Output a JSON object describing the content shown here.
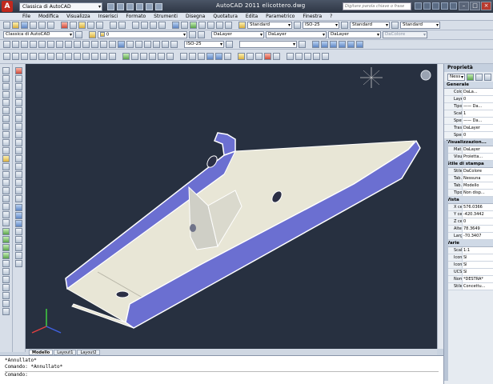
{
  "app": {
    "title": "AutoCAD 2011    elicottero.dwg",
    "workspace": "Classica di AutoCAD",
    "search_placeholder": "Digitare parola chiave o frase"
  },
  "menu": [
    "File",
    "Modifica",
    "Visualizza",
    "Inserisci",
    "Formato",
    "Strumenti",
    "Disegna",
    "Quotatura",
    "Edita",
    "Parametrico",
    "Finestra",
    "?"
  ],
  "toolbar": {
    "text_style": "Standard",
    "dim_style": "ISO-25",
    "table_style": "Standard",
    "mleader_style": "Standard",
    "workspace2": "Classica di AutoCAD",
    "layer_value": "0",
    "color": "DaLayer",
    "linetype": "DaLayer",
    "lineweight": "DaLayer",
    "plotstyle": "DaColore",
    "dim_style2": "ISO-25"
  },
  "viewport": {
    "layout_tabs": [
      "Modello",
      "Layout1",
      "Layout2"
    ],
    "active_tab": "Modello",
    "colors": {
      "background": "#273040",
      "side_walls": "#6b6fd1",
      "floor": "#e8e6d6",
      "edges": "#ffffff"
    }
  },
  "command": {
    "lines": [
      "*Annullato*",
      "Comando: *Annullato*"
    ],
    "prompt": "Comando:"
  },
  "properties": {
    "title": "Proprietà",
    "selection": "Ness",
    "sections": [
      {
        "name": "Generale",
        "rows": [
          [
            "Colore",
            "DaLa..."
          ],
          [
            "Layer",
            "0"
          ],
          [
            "Tipo ...",
            "—— Da..."
          ],
          [
            "Scal...",
            "1"
          ],
          [
            "Spes...",
            "—— Da..."
          ],
          [
            "Tras...",
            "DaLayer"
          ],
          [
            "Spes...",
            "0"
          ]
        ]
      },
      {
        "name": "Visualizzazion...",
        "rows": [
          [
            "Mat...",
            "DaLayer"
          ],
          [
            "Visu...",
            "Proietta..."
          ]
        ]
      },
      {
        "name": "Stile di stampa",
        "rows": [
          [
            "Stile...",
            "DaColore"
          ],
          [
            "Tab...",
            "Nessuna"
          ],
          [
            "Tab...",
            "Modello"
          ],
          [
            "Tipo...",
            "Non disp..."
          ]
        ]
      },
      {
        "name": "Vista",
        "rows": [
          [
            "X ce...",
            "576.0366"
          ],
          [
            "Y ce...",
            "-420.3442"
          ],
          [
            "Z ce...",
            "0"
          ],
          [
            "Altezza",
            "78.3649"
          ],
          [
            "Larg...",
            "-70.3407"
          ]
        ]
      },
      {
        "name": "Varie",
        "rows": [
          [
            "Scal...",
            "1:1"
          ],
          [
            "Icon...",
            "Sì"
          ],
          [
            "Icon...",
            "Sì"
          ],
          [
            "UCS ...",
            "Sì"
          ],
          [
            "Nom...",
            "*DESTRA*"
          ],
          [
            "Stile ...",
            "Concettu..."
          ]
        ]
      }
    ]
  }
}
